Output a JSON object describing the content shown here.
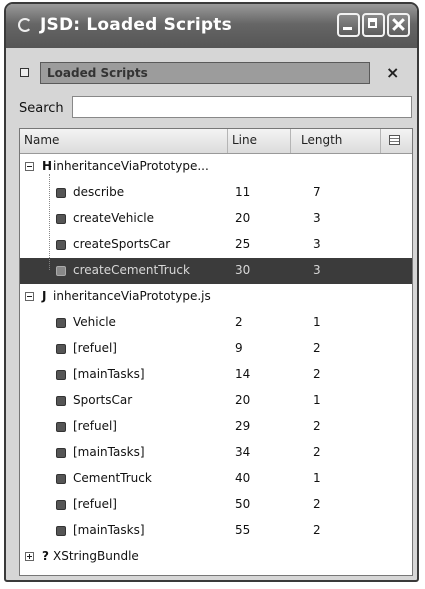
{
  "window": {
    "title": "JSD: Loaded Scripts"
  },
  "panel": {
    "tab_label": "Loaded Scripts",
    "close_label": "×"
  },
  "search": {
    "label": "Search",
    "value": ""
  },
  "columns": {
    "name": "Name",
    "line": "Line",
    "length": "Length"
  },
  "scripts": [
    {
      "marker": "H",
      "name": "inheritanceViaPrototype...",
      "expanded": true,
      "functions": [
        {
          "name": "describe",
          "line": "11",
          "length": "7"
        },
        {
          "name": "createVehicle",
          "line": "20",
          "length": "3"
        },
        {
          "name": "createSportsCar",
          "line": "25",
          "length": "3"
        },
        {
          "name": "createCementTruck",
          "line": "30",
          "length": "3",
          "selected": true
        }
      ]
    },
    {
      "marker": "J",
      "name": "inheritanceViaPrototype.js",
      "expanded": true,
      "functions": [
        {
          "name": "Vehicle",
          "line": "2",
          "length": "1"
        },
        {
          "name": "[refuel]",
          "line": "9",
          "length": "2"
        },
        {
          "name": "[mainTasks]",
          "line": "14",
          "length": "2"
        },
        {
          "name": "SportsCar",
          "line": "20",
          "length": "1"
        },
        {
          "name": "[refuel]",
          "line": "29",
          "length": "2"
        },
        {
          "name": "[mainTasks]",
          "line": "34",
          "length": "2"
        },
        {
          "name": "CementTruck",
          "line": "40",
          "length": "1"
        },
        {
          "name": "[refuel]",
          "line": "50",
          "length": "2"
        },
        {
          "name": "[mainTasks]",
          "line": "55",
          "length": "2"
        }
      ]
    },
    {
      "marker": "?",
      "name": "XStringBundle",
      "expanded": false,
      "functions": []
    }
  ]
}
